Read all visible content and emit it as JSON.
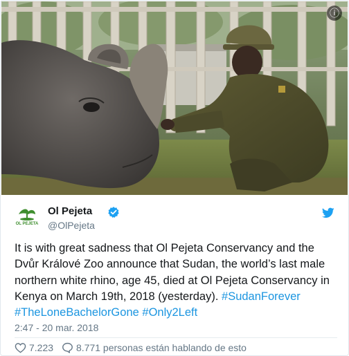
{
  "tweet": {
    "author": {
      "name": "Ol Pejeta",
      "handle": "@OlPejeta",
      "avatar_text": "OL PEJETA"
    },
    "text_main": "It is with great sadness that Ol Pejeta Conservancy and the Dvůr Králové Zoo announce that Sudan, the world’s last male northern white rhino, age 45, died at Ol Pejeta Conservancy in Kenya on March 19th, 2018 (yesterday).",
    "hashtags": [
      "#SudanForever",
      "#TheLoneBachelorGone",
      "#Only2Left"
    ],
    "timestamp": "2:47 - 20 mar. 2018",
    "likes": "7.223",
    "replies_text": "8.771 personas están hablando de esto"
  },
  "icons": {
    "verified": "verified-badge-icon",
    "bird": "twitter-bird-icon",
    "heart": "heart-icon",
    "comment": "speech-bubble-icon",
    "expand": "info-icon"
  },
  "colors": {
    "link": "#1b95e0",
    "verified": "#1da1f2",
    "muted": "#657786",
    "logo_green": "#3e8e2e"
  }
}
